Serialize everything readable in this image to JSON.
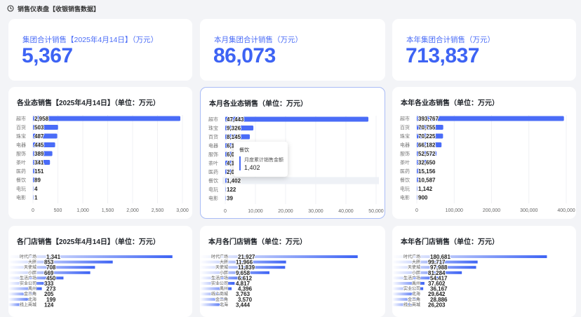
{
  "page": {
    "title": "销售仪表盘【收银销售数据】"
  },
  "colors": {
    "accent": "#3d63f4",
    "bar": "#4a6cf7"
  },
  "kpis": [
    {
      "label": "集团合计销售【2025年4月14日】（万元）",
      "value": "5,367"
    },
    {
      "label": "本月集团合计销售（万元）",
      "value": "86,073"
    },
    {
      "label": "本年集团合计销售（万元）",
      "value": "713,837"
    }
  ],
  "tooltip": {
    "title": "餐饮",
    "label": "月度累计销售金额",
    "value": "1,402"
  },
  "charts": [
    {
      "title": "各业态销售【2025年4月14日】（单位：万元）",
      "chart_data": {
        "type": "bar",
        "orientation": "horizontal",
        "categories": [
          "超市",
          "百货",
          "珠宝",
          "电器",
          "服饰",
          "茶叶",
          "医药",
          "餐饮",
          "电玩",
          "电影"
        ],
        "values": [
          2958,
          503,
          487,
          445,
          389,
          341,
          151,
          89,
          4,
          1
        ],
        "labels": [
          "2,958",
          "503",
          "487",
          "445",
          "389",
          "341",
          "151",
          "89",
          "4",
          "1"
        ],
        "xlim": [
          0,
          3000
        ],
        "xticks": [
          "0",
          "500",
          "1,000",
          "1,500",
          "2,000",
          "2,500",
          "3,000"
        ]
      }
    },
    {
      "title": "本月各业态销售（单位：万元）",
      "chart_data": {
        "type": "bar",
        "orientation": "horizontal",
        "categories": [
          "超市",
          "珠宝",
          "百货",
          "电器",
          "服饰",
          "茶叶",
          "医药",
          "餐饮",
          "电玩",
          "电影"
        ],
        "values": [
          47443,
          9326,
          8145,
          6100,
          6000,
          4100,
          2000,
          1402,
          122,
          39
        ],
        "labels": [
          "47,443",
          "9,326",
          "8,145",
          "6,1",
          "6,0",
          "4,1",
          "2,0",
          "1,402",
          "122",
          "39"
        ],
        "xlim": [
          0,
          50000
        ],
        "xticks": [
          "0",
          "10,000",
          "20,000",
          "30,000",
          "40,000",
          "50,000"
        ]
      }
    },
    {
      "title": "本年各业态销售（单位：万元）",
      "chart_data": {
        "type": "bar",
        "orientation": "horizontal",
        "categories": [
          "超市",
          "百货",
          "珠宝",
          "电器",
          "服饰",
          "茶叶",
          "医药",
          "餐饮",
          "电玩",
          "电影"
        ],
        "values": [
          393767,
          70755,
          70225,
          66182,
          52572,
          32650,
          15156,
          10587,
          1142,
          900
        ],
        "labels": [
          "393,767",
          "70,755",
          "70,225",
          "66,182",
          "52,572",
          "32,650",
          "15,156",
          "10,587",
          "1,142",
          "900"
        ],
        "xlim": [
          0,
          400000
        ],
        "xticks": [
          "0",
          "100,000",
          "200,000",
          "300,000",
          "400,000"
        ]
      }
    },
    {
      "title": "各门店销售【2025年4月14日】（单位：万元）",
      "chart_data": {
        "type": "bar",
        "orientation": "horizontal",
        "categories": [
          "时代广场",
          "大胖",
          "天使城",
          "小胖",
          "生活广场",
          "实业公司",
          "禹州",
          "金三角",
          "北海",
          "线上商城"
        ],
        "values": [
          1341,
          853,
          708,
          669,
          450,
          333,
          273,
          205,
          199,
          124
        ],
        "labels": [
          "1,341",
          "853",
          "708",
          "669",
          "450",
          "333",
          "273",
          "205",
          "199",
          "124"
        ],
        "xlim": [
          0,
          1400
        ]
      }
    },
    {
      "title": "本月各门店销售（单位：万元）",
      "chart_data": {
        "type": "bar",
        "orientation": "horizontal",
        "categories": [
          "时代广场",
          "大胖",
          "天使城",
          "小胖",
          "生活广场",
          "实业公司",
          "禹州",
          "线上商城",
          "金三角",
          "北海"
        ],
        "values": [
          21927,
          11966,
          11839,
          9658,
          6612,
          4817,
          4396,
          3763,
          3570,
          3444
        ],
        "labels": [
          "21,927",
          "11,966",
          "11,839",
          "9,658",
          "6,612",
          "4,817",
          "4,396",
          "3,763",
          "3,570",
          "3,444"
        ],
        "xlim": [
          0,
          24000
        ]
      }
    },
    {
      "title": "本年各门店销售（单位：万元）",
      "chart_data": {
        "type": "bar",
        "orientation": "horizontal",
        "categories": [
          "时代广场",
          "大胖",
          "天使城",
          "小胖",
          "生活广场",
          "禹州",
          "实业公司",
          "北海",
          "金三角",
          "线上商城"
        ],
        "values": [
          180681,
          99717,
          97988,
          81284,
          54417,
          37602,
          36167,
          29642,
          28886,
          26203
        ],
        "labels": [
          "180,681",
          "99,717",
          "97,988",
          "81,284",
          "54,417",
          "37,602",
          "36,167",
          "29,642",
          "28,886",
          "26,203"
        ],
        "xlim": [
          0,
          200000
        ]
      }
    }
  ]
}
